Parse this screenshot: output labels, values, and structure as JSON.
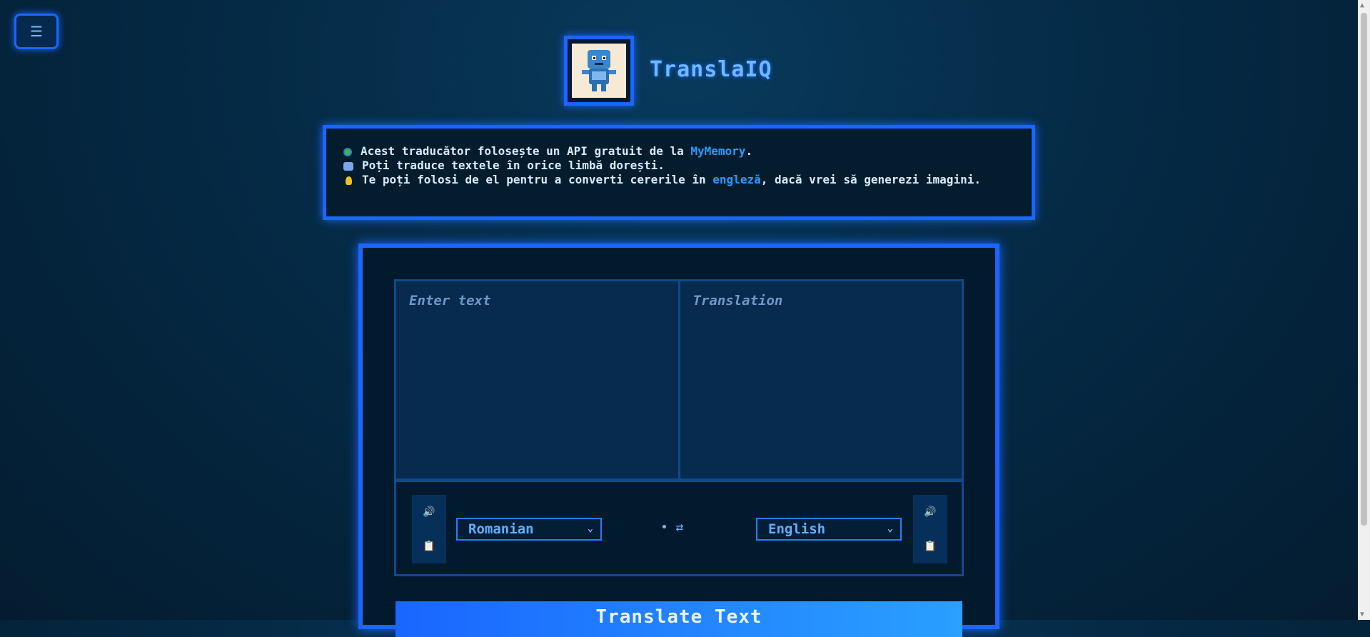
{
  "menu": {
    "icon": "☰"
  },
  "header": {
    "title": "TranslaIQ",
    "logo": "robot-translator-icon"
  },
  "info": {
    "line1_a": "Acest traducător folosește un API gratuit de la ",
    "line1_link": "MyMemory",
    "line1_b": ".",
    "line2": "Poți traduce textele în orice limbă dorești.",
    "line3_a": "Te poți folosi de el pentru a converti cererile în ",
    "line3_link": "engleză",
    "line3_b": ", dacă vrei să generezi imagini."
  },
  "translator": {
    "input_placeholder": "Enter text",
    "output_placeholder": "Translation",
    "source_lang": "Romanian",
    "target_lang": "English",
    "swap": "• ⇄",
    "translate_label": "Translate Text"
  },
  "colors": {
    "accent": "#1a66ff",
    "link": "#2b9bff",
    "background": "#041c30"
  }
}
